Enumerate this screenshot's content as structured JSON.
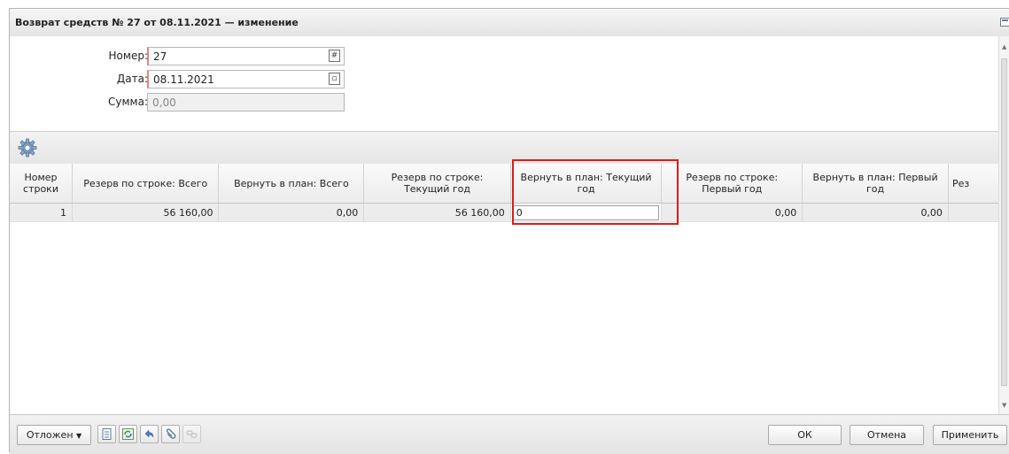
{
  "window": {
    "title": "Возврат средств № 27 от 08.11.2021 — изменение"
  },
  "form": {
    "number_label": "Номер:",
    "number_value": "27",
    "date_label": "Дата:",
    "date_value": "08.11.2021",
    "sum_label": "Сумма:",
    "sum_value": "0,00"
  },
  "grid": {
    "columns": [
      "Номер строки",
      "Резерв по строке: Всего",
      "Вернуть в план: Всего",
      "Резерв по строке: Текущий год",
      "Вернуть в план: Текущий год",
      "Резерв по строке: Первый год",
      "Вернуть в план: Первый год",
      "Рез"
    ],
    "rows": [
      {
        "num": "1",
        "reserve_total": "56 160,00",
        "return_total": "0,00",
        "reserve_current": "56 160,00",
        "return_current": "0",
        "reserve_first": "0,00",
        "return_first": "0,00",
        "reserve_next": ""
      }
    ]
  },
  "bottom": {
    "status_label": "Отложен",
    "ok_label": "ОК",
    "cancel_label": "Отмена",
    "apply_label": "Применить"
  },
  "colors": {
    "highlight": "#e01b1b",
    "required": "#e88484"
  }
}
